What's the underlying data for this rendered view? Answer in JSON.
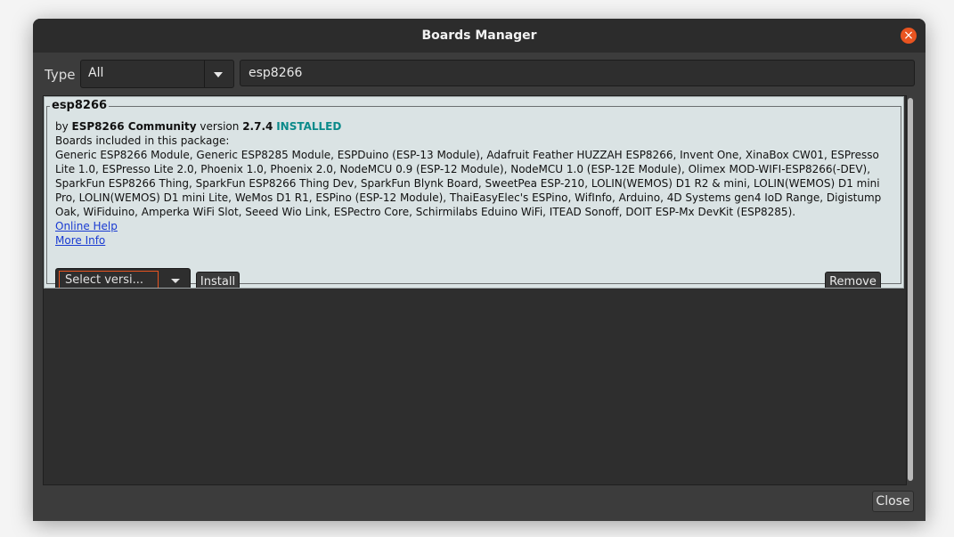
{
  "window": {
    "title": "Boards Manager",
    "close_icon": "×"
  },
  "filter": {
    "type_label": "Type",
    "type_value": "All",
    "search_value": "esp8266"
  },
  "board": {
    "name": "esp8266",
    "by_prefix": "by",
    "author": "ESP8266 Community",
    "version_label": "version",
    "version": "2.7.4",
    "status": "INSTALLED",
    "included_label": "Boards included in this package:",
    "boards": "Generic ESP8266 Module, Generic ESP8285 Module, ESPDuino (ESP-13 Module), Adafruit Feather HUZZAH ESP8266, Invent One, XinaBox CW01, ESPresso Lite 1.0, ESPresso Lite 2.0, Phoenix 1.0, Phoenix 2.0, NodeMCU 0.9 (ESP-12 Module), NodeMCU 1.0 (ESP-12E Module), Olimex MOD-WIFI-ESP8266(-DEV), SparkFun ESP8266 Thing, SparkFun ESP8266 Thing Dev, SparkFun Blynk Board, SweetPea ESP-210, LOLIN(WEMOS) D1 R2 & mini, LOLIN(WEMOS) D1 mini Pro, LOLIN(WEMOS) D1 mini Lite, WeMos D1 R1, ESPino (ESP-12 Module), ThaiEasyElec's ESPino, WifInfo, Arduino, 4D Systems gen4 IoD Range, Digistump Oak, WiFiduino, Amperka WiFi Slot, Seeed Wio Link, ESPectro Core, Schirmilabs Eduino WiFi, ITEAD Sonoff, DOIT ESP-Mx DevKit (ESP8285).",
    "online_help": "Online Help",
    "more_info": "More Info",
    "version_select": "Select versi...",
    "install_label": "Install",
    "remove_label": "Remove"
  },
  "footer": {
    "close_label": "Close"
  },
  "colors": {
    "accent": "#e95420",
    "installed": "#0a8a8a",
    "card_bg": "#dae3e4",
    "window_bg": "#3c3c3c"
  }
}
